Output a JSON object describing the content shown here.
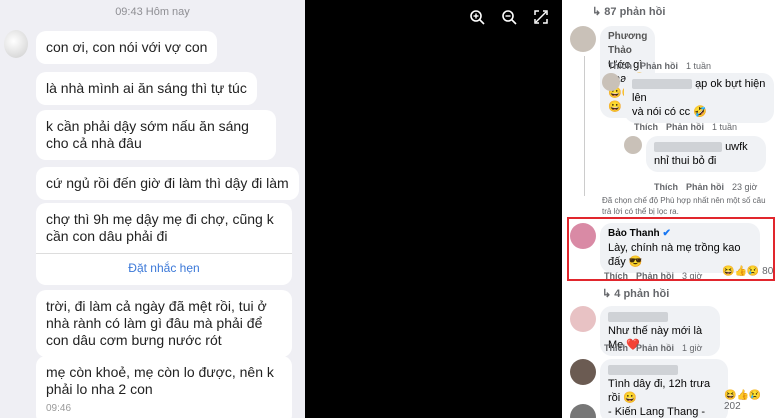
{
  "photo": {
    "time_header": "09:43 Hôm nay",
    "messages": [
      "con ơi, con nói với vợ con",
      "là nhà mình ai ăn sáng thì tự túc",
      "k cần phải dậy sớm nấu ăn sáng cho cả nhà đâu",
      "cứ ngủ rồi đến giờ đi làm thì dậy đi làm",
      "chợ thì 9h mẹ dậy mẹ đi chợ, cũng k cần con dâu phải đi",
      "trời, đi làm cả ngày đã mệt rồi, tui ở nhà rành có làm gì đâu mà phải để con dâu cơm bưng nước rót",
      "mẹ còn khoẻ, mẹ còn lo được, nên k phải lo nha 2 con"
    ],
    "remind_label": "Đặt nhắc hẹn",
    "last_time": "09:46"
  },
  "viewer_icons": [
    "zoom-in-icon",
    "zoom-out-icon",
    "fullscreen-icon"
  ],
  "comments": {
    "replies_87": "87 phản hồi",
    "c1": {
      "name": "Phương Thảo",
      "text": "Ước gì aaaa😀😀😀😀"
    },
    "c1_actions": {
      "like": "Thích",
      "reply": "Phản hồi",
      "time": "1 tuần"
    },
    "c2": {
      "text_a": "ạp ok bựt hiện lên",
      "text_b": "và nói có cc 🤣"
    },
    "c2_actions": {
      "like": "Thích",
      "reply": "Phản hồi",
      "time": "1 tuần"
    },
    "c3": {
      "text_a": "uwfk",
      "text_b": "nhỉ thui bỏ đi"
    },
    "c3_actions": {
      "like": "Thích",
      "reply": "Phản hồi",
      "time": "23 giờ"
    },
    "note": "Đã chọn chế độ Phù hợp nhất nên một số câu trả lời có thể bị lọc ra.",
    "c4": {
      "name": "Bảo Thanh",
      "text": "Lày, chính nà mẹ trồng kao đấy 😎"
    },
    "c4_actions": {
      "like": "Thích",
      "reply": "Phản hồi",
      "time": "3 giờ"
    },
    "c4_reactions": "80",
    "replies_4": "4 phản hồi",
    "c5": {
      "text": "Như thế này mới là Mẹ ❤️"
    },
    "c5_actions": {
      "like": "Thích",
      "reply": "Phản hồi",
      "time": "1 giờ"
    },
    "c6": {
      "text_a": "Tình dây đi, 12h trưa rồi 😀",
      "text_b": "- Kiến Lang Thang -"
    },
    "c6_reactions": "202"
  }
}
